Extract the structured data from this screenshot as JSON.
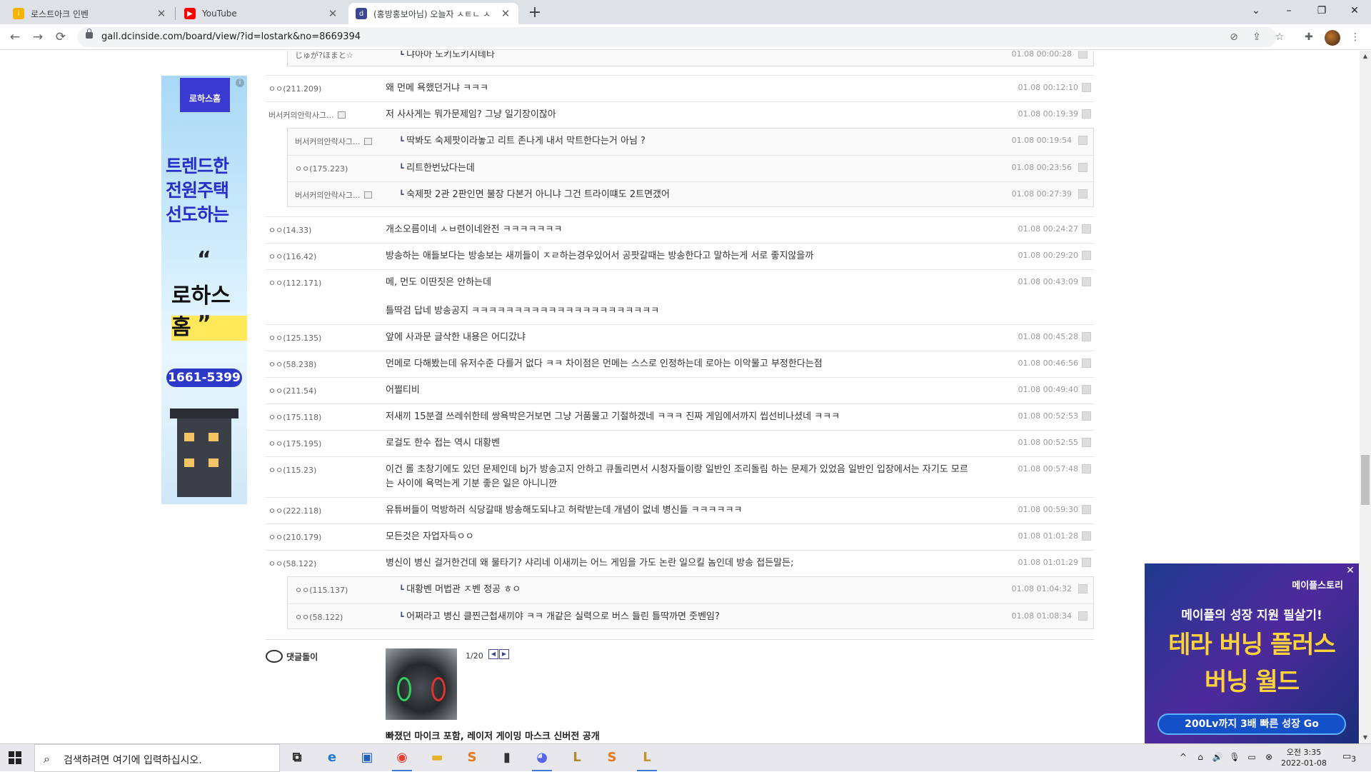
{
  "tabs": [
    {
      "title": "로스트아크 인벤",
      "favicon_color": "#f5b400",
      "active": false
    },
    {
      "title": "YouTube",
      "favicon_color": "#ff0000",
      "active": false
    },
    {
      "title": "(홍방홍보아님) 오늘자 ㅅㅌㄴ ㅅ",
      "favicon_color": "#3b4890",
      "active": true
    }
  ],
  "newtab_label": "+",
  "window_controls": {
    "tab_search": "⌄",
    "minimize": "–",
    "maximize": "❐",
    "close": "✕"
  },
  "nav": {
    "back": "←",
    "forward": "→",
    "reload": "⟳"
  },
  "url": "gall.dcinside.com/board/view/?id=lostark&no=8669394",
  "toolbar_icons": {
    "eye": "⊘",
    "share": "⇪",
    "star": "☆",
    "extensions": "✚",
    "menu": "⋮"
  },
  "comments": [
    {
      "nick": "ㅇㅇ(211.209)",
      "text": "왜 먼메 욕했던거냐 ㅋㅋㅋ",
      "date": "01.08 00:12:10"
    },
    {
      "nick": "버서커의안락사그...",
      "gallog": true,
      "text": "저 사사게는 뭐가문제임? 그냥 일기장이잖아",
      "date": "01.08 00:19:39",
      "replies": [
        {
          "nick": "버서커의안락사그...",
          "gallog": true,
          "text": "딱봐도 숙제팟이라놓고 리트 존나게 내서 막트한다는거 아님 ?",
          "date": "01.08 00:19:54"
        },
        {
          "nick": "ㅇㅇ(175.223)",
          "text": "리트한번났다는데",
          "date": "01.08 00:23:56"
        },
        {
          "nick": "버서커의안락사그...",
          "gallog": true,
          "text": "숙제팟 2관 2판인면 불장 다본거 아니냐 그건 트라이떄도 2트면갰어",
          "date": "01.08 00:27:39"
        }
      ]
    },
    {
      "nick": "ㅇㅇ(14.33)",
      "text": "개소오름이네 ㅅㅂ련이네완전 ㅋㅋㅋㅋㅋㅋㅋ",
      "date": "01.08 00:24:27"
    },
    {
      "nick": "ㅇㅇ(116.42)",
      "text": "방송하는 애들보다는 방송보는 새끼들이 ㅈㄹ하는경우있어서 공팟갈때는 방송한다고 말하는게 서로 좋지않을까",
      "date": "01.08 00:29:20"
    },
    {
      "nick": "ㅇㅇ(112.171)",
      "text": "메, 먼도 이딴짓은 안하는데\n\n틀딱검 답네 방송공지 ㅋㅋㅋㅋㅋㅋㅋㅋㅋㅋㅋㅋㅋㅋㅋㅋㅋㅋㅋㅋㅋㅋ",
      "date": "01.08 00:43:09"
    },
    {
      "nick": "ㅇㅇ(125.135)",
      "text": "앞에 사과문 글삭한 내용은 어디갔냐",
      "date": "01.08 00:45:28"
    },
    {
      "nick": "ㅇㅇ(58.238)",
      "text": "먼메로 다해봤는데 유저수준 다를거 없다 ㅋㅋ 차이점은 먼메는 스스로 인정하는데 로아는 이악물고 부정한다는점",
      "date": "01.08 00:46:56"
    },
    {
      "nick": "ㅇㅇ(211.54)",
      "text": "어쩔티비",
      "date": "01.08 00:49:40"
    },
    {
      "nick": "ㅇㅇ(175.118)",
      "text": "저새끼 15분결 쓰레쉬한테 쌍욕박은거보면 그냥 거품물고 기절하겠네 ㅋㅋㅋ 진짜 게임에서까지 씹선비나셨네 ㅋㅋㅋ",
      "date": "01.08 00:52:53"
    },
    {
      "nick": "ㅇㅇ(175.195)",
      "text": "로걸도 한수 접는 역시 대황벤",
      "date": "01.08 00:52:55"
    },
    {
      "nick": "ㅇㅇ(115.23)",
      "text": "이건 롤 초창기에도 있던 문제인데 bj가 방송고지 안하고 큐돌리면서 시청자들이랑 일반인 조리돌림 하는 문제가 있었음 일반인 입장에서는 자기도 모르는 사이에 욕먹는게 기분 좋은 일은 아니니깐",
      "date": "01.08 00:57:48"
    },
    {
      "nick": "ㅇㅇ(222.118)",
      "text": "유튜버들이 먹방하러 식당갈때 방송해도되냐고 허락받는데 개념이 없네 병신들 ㅋㅋㅋㅋㅋㅋ",
      "date": "01.08 00:59:30"
    },
    {
      "nick": "ㅇㅇ(210.179)",
      "text": "모든것은 자업자득ㅇㅇ",
      "date": "01.08 01:01:28"
    },
    {
      "nick": "ㅇㅇ(58.122)",
      "text": "병신이 병신 걸거한건데 왜 물타기? 샤리네 이새끼는 어느 게임을 가도 논란 일으킬 놈인데 방송 접든말든;",
      "date": "01.08 01:01:29",
      "replies": [
        {
          "nick": "ㅇㅇ(115.137)",
          "text": "대황벤 머법관 ㅈ벤 정공 ㅎㅇ",
          "date": "01.08 01:04:32"
        },
        {
          "nick": "ㅇㅇ(58.122)",
          "text": "어쩌라고 병신 클찐근첩새끼야 ㅋㅋ 개같은 실력으로 버스 들린 틀딱까면 줏벤임?",
          "date": "01.08 01:08:34"
        }
      ]
    }
  ],
  "top_partial_reply": {
    "nick": "じゅが?ほまと☆",
    "text": "냐아아 도키도키시테타",
    "date": "01.08 00:00:28"
  },
  "dccon": {
    "label": "댓글돌이",
    "counter": "1/20",
    "prev": "◀",
    "next": "▶",
    "caption": "빠졌던 마이크 포함, 레이저 게이밍 마스크 신버전 공개"
  },
  "ad_left": {
    "logo": "로하스홈",
    "headline": [
      "트렌드한",
      "전원주택",
      "선도하는"
    ],
    "open_quote": "“",
    "brand": "로하스홈",
    "close_quote": "”",
    "phone": "1661-5399",
    "info": "i"
  },
  "ad_right": {
    "brand": "메이플스토리",
    "tagline": "메이플의 성장 지원 필살기!",
    "big1": "테라 버닝 플러스",
    "big2": "버닝 월드",
    "cta": "200Lv까지 3배 빠른 성장 Go",
    "close": "✕"
  },
  "taskbar": {
    "search_placeholder": "검색하려면 여기에 입력하십시오.",
    "search_icon": "⌕",
    "apps": [
      {
        "name": "task-view",
        "glyph": "⧉",
        "color": "#222"
      },
      {
        "name": "edge",
        "glyph": "e",
        "color": "#1f7ad6"
      },
      {
        "name": "store",
        "glyph": "▣",
        "color": "#1f5fbf"
      },
      {
        "name": "chrome",
        "glyph": "◉",
        "color": "#e34133",
        "running": true
      },
      {
        "name": "file-explorer",
        "glyph": "▬",
        "color": "#e6b12e"
      },
      {
        "name": "app-s-1",
        "glyph": "S",
        "color": "#e8791e"
      },
      {
        "name": "app-book",
        "glyph": "▮",
        "color": "#333"
      },
      {
        "name": "discord",
        "glyph": "◕",
        "color": "#5865f2",
        "running": true
      },
      {
        "name": "app-game-1",
        "glyph": "L",
        "color": "#b38a2e"
      },
      {
        "name": "app-s-2",
        "glyph": "S",
        "color": "#e8791e"
      },
      {
        "name": "app-game-2",
        "glyph": "L",
        "color": "#c2922f",
        "running": true
      }
    ],
    "tray_icons": [
      "^",
      "⌂",
      "🔊",
      "🎙",
      "▭",
      "⊗"
    ],
    "time": "오전 3:35",
    "date": "2022-01-08",
    "notification": "3"
  }
}
